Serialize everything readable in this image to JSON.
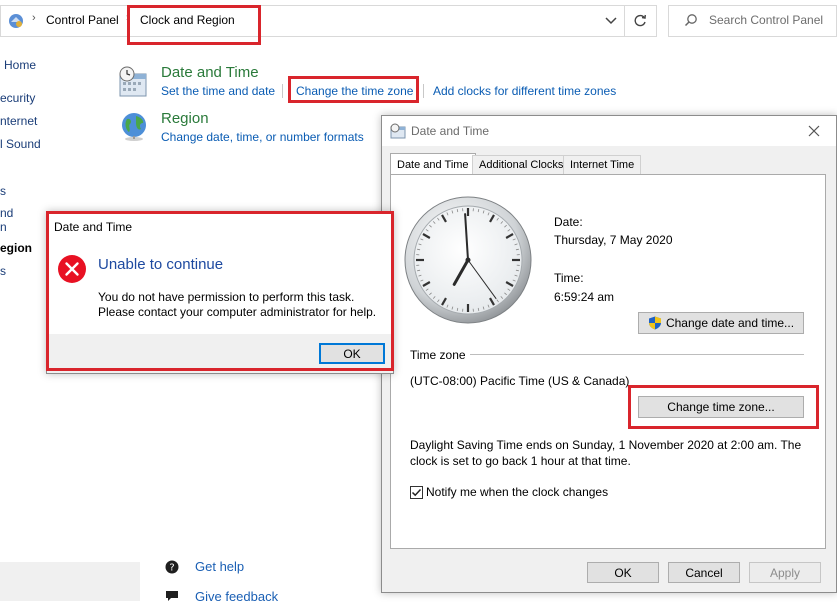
{
  "address_bar": {
    "crumb_1": "Control Panel",
    "crumb_2": "Clock and Region",
    "dropdown_icon": "chevron-down-icon",
    "refresh_icon": "refresh-icon"
  },
  "search": {
    "placeholder": "Search Control Panel"
  },
  "sidebar": {
    "items": [
      {
        "label": "Home"
      },
      {
        "label": "ecurity"
      },
      {
        "label": "nternet"
      },
      {
        "label": "l Sound"
      },
      {
        "label": "s"
      },
      {
        "label": "nd"
      },
      {
        "label": "n"
      },
      {
        "label": "egion"
      },
      {
        "label": "s"
      }
    ]
  },
  "main": {
    "date_time": {
      "title": "Date and Time",
      "links": [
        "Set the time and date",
        "Change the time zone",
        "Add clocks for different time zones"
      ]
    },
    "region": {
      "title": "Region",
      "link": "Change date, time, or number formats"
    },
    "see_also": {
      "get_help": "Get help",
      "give_feedback": "Give feedback"
    }
  },
  "error_dialog": {
    "title": "Date and Time",
    "heading": "Unable to continue",
    "message_line_1": "You do not have permission to perform this task.",
    "message_line_2": "Please contact your computer administrator for help.",
    "ok_label": "OK"
  },
  "dt_dialog": {
    "title": "Date and Time",
    "tabs": [
      "Date and Time",
      "Additional Clocks",
      "Internet Time"
    ],
    "clock_time": {
      "hour": 6,
      "minute": 59,
      "second": 24
    },
    "date_label": "Date:",
    "date_value": "Thursday, 7 May 2020",
    "time_label": "Time:",
    "time_value": "6:59:24 am",
    "change_datetime_label": "Change date and time...",
    "timezone_header": "Time zone",
    "timezone_value": "(UTC-08:00) Pacific Time (US & Canada)",
    "change_timezone_label": "Change time zone...",
    "dst_line_1": "Daylight Saving Time ends on Sunday, 1 November 2020 at 2:00 am. The",
    "dst_line_2": "clock is set to go back 1 hour at that time.",
    "notify_label": "Notify me when the clock changes",
    "notify_checked": true,
    "ok_label": "OK",
    "cancel_label": "Cancel",
    "apply_label": "Apply"
  },
  "colors": {
    "highlight_red": "#d9252c",
    "link_blue": "#0a5cb3",
    "category_green": "#2a7a3a",
    "error_red": "#e81123"
  }
}
